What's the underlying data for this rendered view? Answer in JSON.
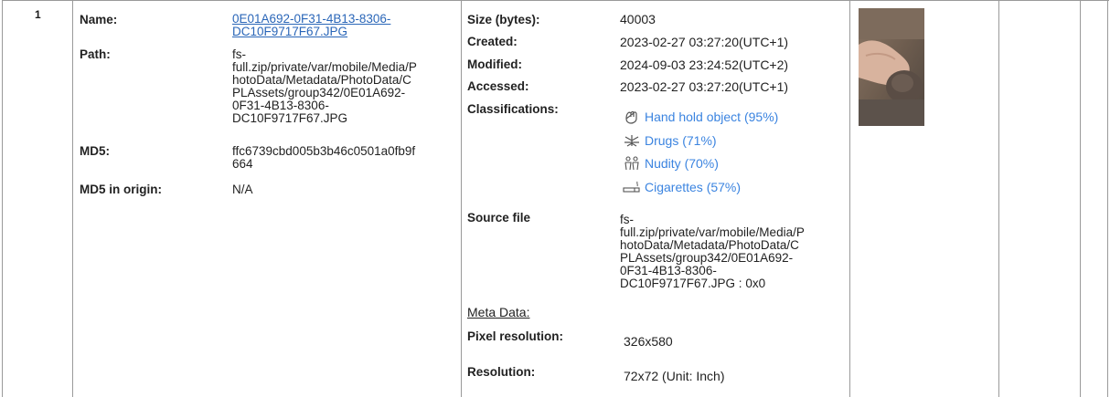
{
  "row": {
    "number": "1",
    "labels": {
      "name": "Name:",
      "path": "Path:",
      "md5": "MD5:",
      "md5_origin": "MD5 in origin:",
      "size": "Size (bytes):",
      "created": "Created:",
      "modified": "Modified:",
      "accessed": "Accessed:",
      "classifications": "Classifications:",
      "source_file": "Source file",
      "meta_data": "Meta Data:",
      "pixel_resolution": "Pixel resolution:",
      "resolution": "Resolution:"
    },
    "name_lines": [
      "0E01A692-0F31-4B13-8306-",
      "DC10F9717F67.JPG"
    ],
    "path_lines": [
      "fs-",
      "full.zip/private/var/mobile/Media/P",
      "hotoData/Metadata/PhotoData/C",
      "PLAssets/group342/0E01A692-",
      "0F31-4B13-8306-",
      "DC10F9717F67.JPG"
    ],
    "md5_lines": [
      "ffc6739cbd005b3b46c0501a0fb9f",
      "664"
    ],
    "md5_origin": "N/A",
    "size": "40003",
    "created": "2023-02-27 03:27:20(UTC+1)",
    "modified": "2024-09-03 23:24:52(UTC+2)",
    "accessed": "2023-02-27 03:27:20(UTC+1)",
    "classifications": [
      {
        "label": "Hand hold object (95%)",
        "icon": "hand-icon"
      },
      {
        "label": "Drugs (71%)",
        "icon": "cannabis-leaf-icon"
      },
      {
        "label": "Nudity (70%)",
        "icon": "nudity-figures-icon"
      },
      {
        "label": "Cigarettes (57%)",
        "icon": "cigarette-icon"
      }
    ],
    "source_file_lines": [
      "fs-",
      "full.zip/private/var/mobile/Media/P",
      "hotoData/Metadata/PhotoData/C",
      "PLAssets/group342/0E01A692-",
      "0F31-4B13-8306-",
      "DC10F9717F67.JPG : 0x0"
    ],
    "pixel_resolution": "326x580",
    "resolution": "72x72 (Unit: Inch)"
  },
  "colors": {
    "link": "#2a66b8",
    "classification": "#3b84e0",
    "border": "#9a9a9a"
  }
}
